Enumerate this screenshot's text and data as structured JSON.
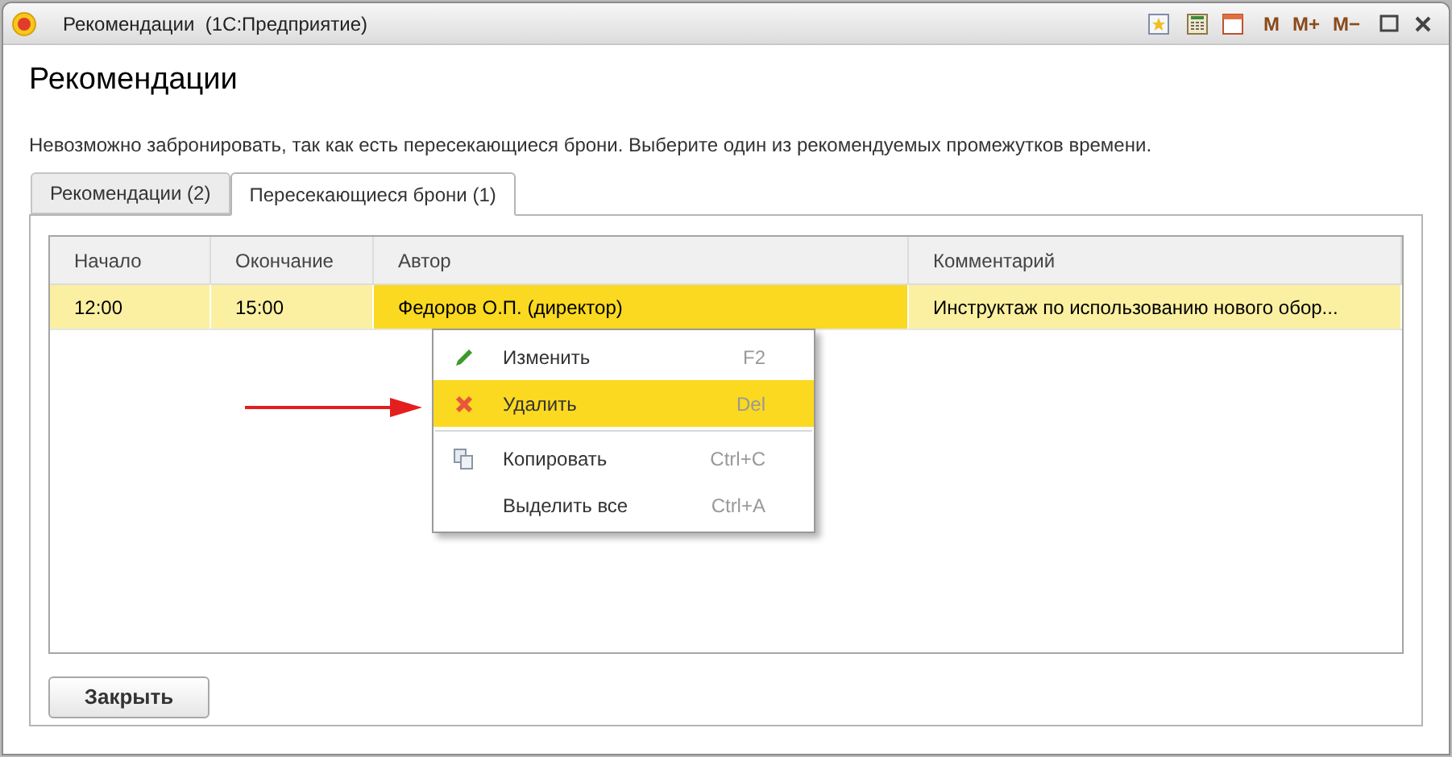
{
  "window": {
    "title": "Рекомендации  (1С:Предприятие)",
    "memory_buttons": [
      "M",
      "M+",
      "M−"
    ]
  },
  "heading": "Рекомендации",
  "message": "Невозможно забронировать, так как есть пересекающиеся брони. Выберите один из рекомендуемых промежутков времени.",
  "tabs": [
    {
      "label": "Рекомендации (2)",
      "selected": false
    },
    {
      "label": "Пересекающиеся брони (1)",
      "selected": true
    }
  ],
  "table": {
    "columns": [
      "Начало",
      "Окончание",
      "Автор",
      "Комментарий"
    ],
    "rows": [
      {
        "selected": true,
        "cells": [
          {
            "text": "12:00",
            "current": false
          },
          {
            "text": "15:00",
            "current": false
          },
          {
            "text": "Федоров О.П. (директор)",
            "current": true
          },
          {
            "text": "Инструктаж по использованию нового обор...",
            "current": false
          }
        ]
      }
    ]
  },
  "context_menu": [
    {
      "label": "Изменить",
      "shortcut": "F2",
      "selected": false,
      "separator_before": false
    },
    {
      "label": "Удалить",
      "shortcut": "Del",
      "selected": true,
      "separator_before": false
    },
    {
      "label": "Копировать",
      "shortcut": "Ctrl+C",
      "selected": false,
      "separator_before": true
    },
    {
      "label": "Выделить все",
      "shortcut": "Ctrl+A",
      "selected": false,
      "separator_before": false
    }
  ],
  "close_button": "Закрыть"
}
